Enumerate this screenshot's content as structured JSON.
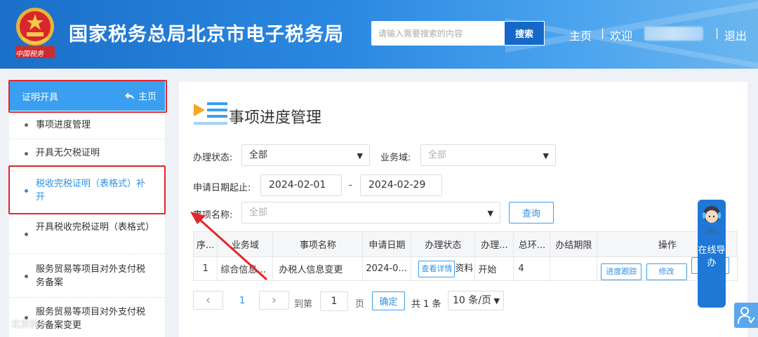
{
  "header": {
    "site_title": "国家税务总局北京市电子税务局",
    "search_placeholder": "请输入需要搜索的内容",
    "search_button": "搜索",
    "nav_home": "主页",
    "separator": "|",
    "welcome": "欢迎",
    "logout": "退出",
    "emblem_caption": "中国税务"
  },
  "sidebar": {
    "title": "证明开具",
    "home_label": "主页",
    "items": [
      {
        "label": "事项进度管理"
      },
      {
        "label": "开具无欠税证明"
      },
      {
        "label": "税收完税证明（表格式）补开"
      },
      {
        "label": "开具税收完税证明（表格式）"
      },
      {
        "label": "服务贸易等项目对外支付税务备案"
      },
      {
        "label": "服务贸易等项目对外支付税务备案变更"
      }
    ]
  },
  "main": {
    "page_title": "事项进度管理",
    "filters": {
      "status_label": "办理状态:",
      "status_value": "全部",
      "domain_label": "业务域:",
      "domain_value": "全部",
      "date_label": "申请日期起止:",
      "date_from": "2024-02-01",
      "date_sep": "-",
      "date_to": "2024-02-29",
      "item_label": "事项名称:",
      "item_value": "全部",
      "query_button": "查询"
    },
    "table": {
      "headers": [
        "序...",
        "业务域",
        "事项名称",
        "申请日期",
        "办理状态",
        "办理...",
        "总环...",
        "办结期限",
        "操作"
      ],
      "rows": [
        {
          "index": "1",
          "domain": "综合信息...",
          "item_name": "办税人信息变更",
          "apply_date": "2024-0...",
          "status_button": "查看详情",
          "status_extra": "资料",
          "stage": "开始",
          "total_steps": "4",
          "deadline": "",
          "op_track": "进度跟踪",
          "op_modify": "修改"
        }
      ]
    },
    "pagination": {
      "prev": "‹",
      "current_page": "1",
      "next": "›",
      "goto_label": "到第",
      "goto_value": "1",
      "page_unit": "页",
      "confirm": "确定",
      "total": "共 1 条",
      "page_size": "10 条/页"
    }
  },
  "float": {
    "online_label": "在线导办"
  },
  "watermark": "北京税务"
}
